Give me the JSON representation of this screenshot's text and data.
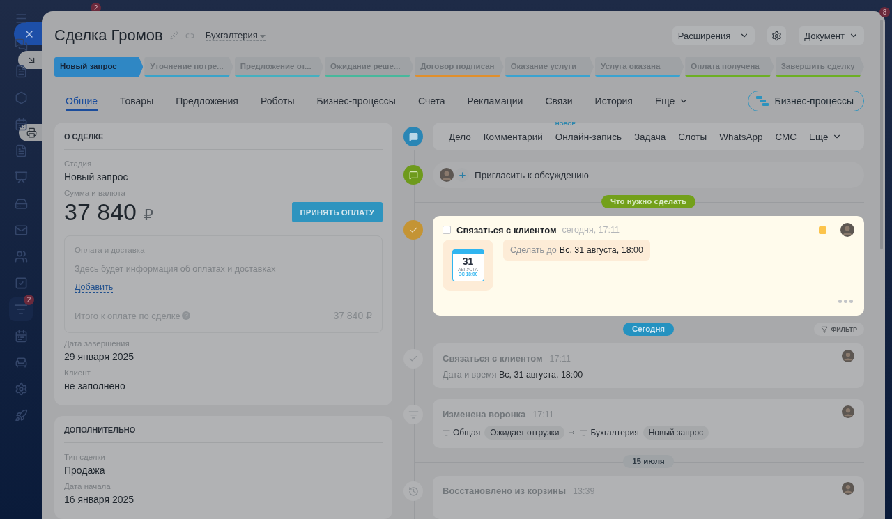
{
  "header": {
    "title": "Сделка Громов",
    "category": "Бухгалтерия",
    "extensions_button": "Расширения",
    "document_button": "Документ"
  },
  "sidebar": {
    "menu_badge": "2",
    "corner_badge": "8",
    "funnel_badge": "2"
  },
  "stages": [
    {
      "label": "Новый запрос",
      "selected": true,
      "color": "#2f87c4"
    },
    {
      "label": "Уточнение потре...",
      "selected": false,
      "color": "#3aa3c9"
    },
    {
      "label": "Предложение от...",
      "selected": false,
      "color": "#45b0c0"
    },
    {
      "label": "Ожидание реше...",
      "selected": false,
      "color": "#47b89c"
    },
    {
      "label": "Договор подписан",
      "selected": false,
      "color": "#e08f2c"
    },
    {
      "label": "Оказание услуги",
      "selected": false,
      "color": "#3aa3d0"
    },
    {
      "label": "Услуга оказана",
      "selected": false,
      "color": "#3aa3d0"
    },
    {
      "label": "Оплата получена",
      "selected": false,
      "color": "#6daf24"
    },
    {
      "label": "Завершить сделку",
      "selected": false,
      "color": "#6daf24"
    }
  ],
  "tabs": [
    {
      "label": "Общие",
      "selected": true,
      "kind": "tab"
    },
    {
      "label": "Товары",
      "selected": false,
      "kind": "tab"
    },
    {
      "label": "Предложения",
      "selected": false,
      "kind": "tab"
    },
    {
      "label": "Роботы",
      "selected": false,
      "kind": "tab"
    },
    {
      "label": "Бизнес-процессы",
      "selected": false,
      "kind": "tab"
    },
    {
      "label": "Счета",
      "selected": false,
      "kind": "tab"
    },
    {
      "label": "Рекламации",
      "selected": false,
      "kind": "tab"
    },
    {
      "label": "Связи",
      "selected": false,
      "kind": "tab"
    },
    {
      "label": "История",
      "selected": false,
      "kind": "tab"
    },
    {
      "label": "Еще",
      "selected": false,
      "kind": "more"
    }
  ],
  "process_button": "Бизнес-процессы",
  "about": {
    "title": "О СДЕЛКЕ",
    "stage_label": "Стадия",
    "stage_value": "Новый запрос",
    "amount_label": "Сумма и валюта",
    "amount": "37 840",
    "currency": "₽",
    "pay_button": "ПРИНЯТЬ ОПЛАТУ",
    "payment": {
      "title": "Оплата и доставка",
      "text": "Здесь будет информация об оплатах и доставках",
      "link": "Добавить",
      "total_label": "Итого к оплате по сделке",
      "total": "37 840 ₽"
    },
    "fields": [
      {
        "label": "Дата завершения",
        "value": "29 января 2025"
      },
      {
        "label": "Клиент",
        "value": "не заполнено"
      }
    ]
  },
  "extra": {
    "title": "ДОПОЛНИТЕЛЬНО",
    "fields": [
      {
        "label": "Тип сделки",
        "value": "Продажа"
      },
      {
        "label": "Дата начала",
        "value": "16 января 2025"
      }
    ]
  },
  "timeline": {
    "composer": [
      {
        "label": "Дело"
      },
      {
        "label": "Комментарий"
      },
      {
        "label": "Онлайн-запись",
        "badge": "НОВОЕ"
      },
      {
        "label": "Задача"
      },
      {
        "label": "Слоты"
      },
      {
        "label": "WhatsApp"
      },
      {
        "label": "СМС"
      },
      {
        "label": "Еще",
        "kind": "more"
      }
    ],
    "invite": "Пригласить к обсуждению",
    "todo_pill": "Что нужно сделать",
    "activity": {
      "checked": false,
      "title": "Связаться с клиентом",
      "time": "сегодня, 17:11",
      "day": "31",
      "month": "АВГУСТА",
      "weekday_time": "ВС 18:00",
      "deadline_label": "Сделать до",
      "deadline": "Вс, 31 августа, 18:00"
    },
    "today_pill": "Сегодня",
    "filter_button": "ФИЛЬТР",
    "history": [
      {
        "kind": "done",
        "title": "Связаться с клиентом",
        "time": "17:11",
        "label": "Дата и время",
        "value": "Вс, 31 августа, 18:00"
      },
      {
        "kind": "funnel",
        "title": "Изменена воронка",
        "time": "17:11",
        "from_funnel": "Общая",
        "from_stage": "Ожидает отгрузки",
        "to_funnel": "Бухгалтерия",
        "to_stage": "Новый запрос"
      },
      {
        "kind": "date",
        "label": "15 июля"
      },
      {
        "kind": "restored",
        "title": "Восстановлено из корзины",
        "time": "13:39"
      }
    ]
  }
}
